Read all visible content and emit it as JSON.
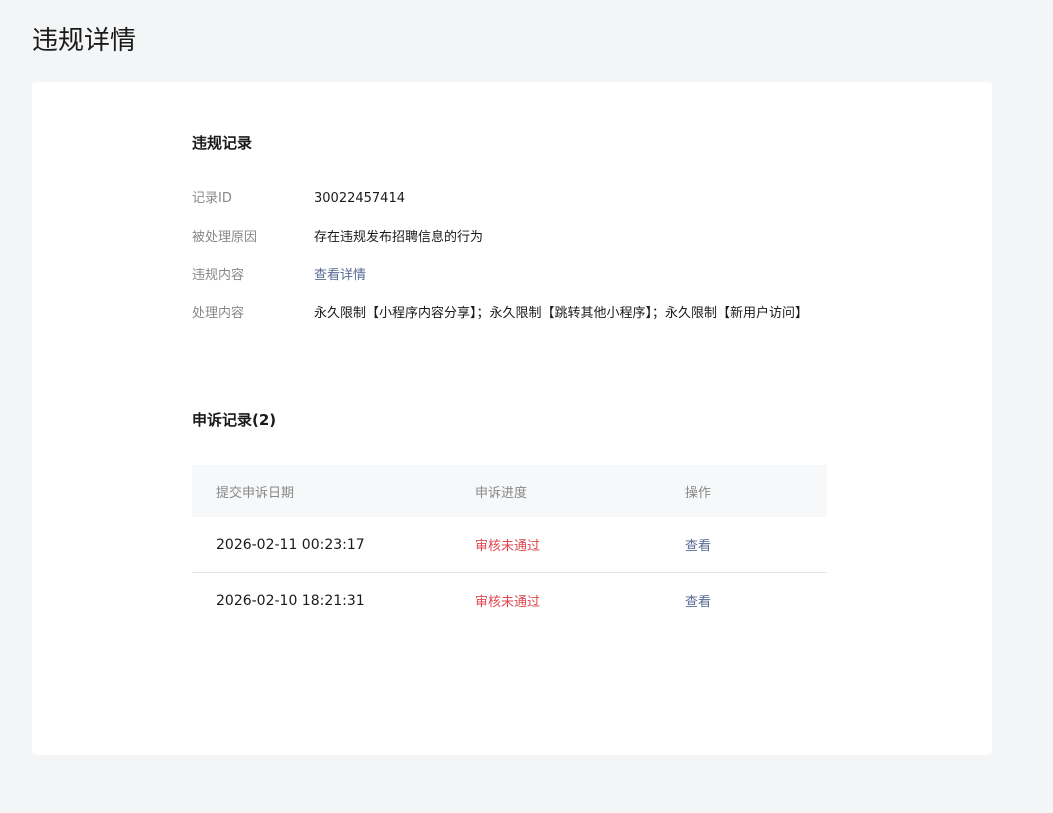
{
  "page": {
    "title": "违规详情"
  },
  "violation": {
    "section_title": "违规记录",
    "rows": [
      {
        "label": "记录ID",
        "value": "30022457414"
      },
      {
        "label": "被处理原因",
        "value": "存在违规发布招聘信息的行为"
      },
      {
        "label": "违规内容",
        "value": "查看详情"
      },
      {
        "label": "处理内容",
        "value": "永久限制【小程序内容分享】；永久限制【跳转其他小程序】；永久限制【新用户访问】"
      }
    ]
  },
  "appeal": {
    "section_title": "申诉记录(2)",
    "columns": [
      "提交申诉日期",
      "申诉进度",
      "操作"
    ],
    "rows": [
      {
        "date": "2026-02-11 00:23:17",
        "status": "审核未通过",
        "action": "查看"
      },
      {
        "date": "2026-02-10 18:21:31",
        "status": "审核未通过",
        "action": "查看"
      }
    ]
  },
  "colors": {
    "link": "#576b95",
    "status_fail": "#e0474f",
    "background": "#f4f5f7"
  }
}
